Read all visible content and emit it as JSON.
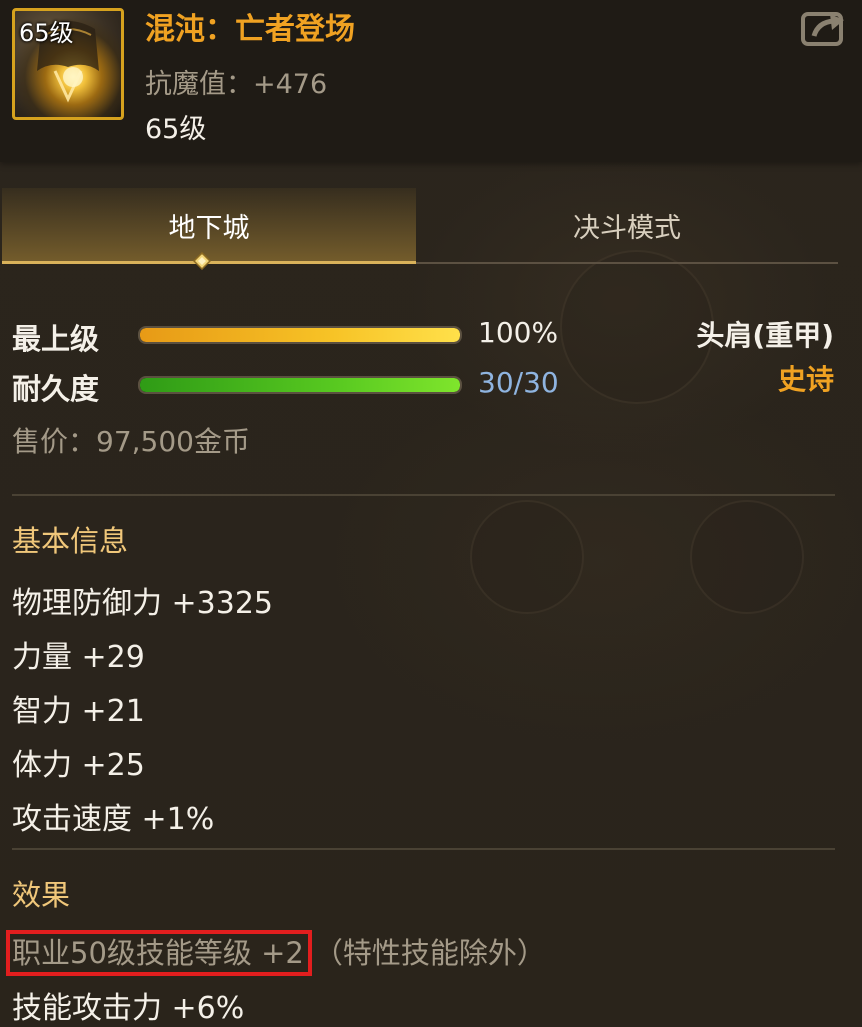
{
  "item": {
    "icon_level": "65级",
    "name": "混沌：亡者登场",
    "resist": "抗魔值：+476",
    "level": "65级",
    "share_icon": "share-icon"
  },
  "tabs": [
    {
      "label": "地下城",
      "active": true
    },
    {
      "label": "决斗模式",
      "active": false
    }
  ],
  "grade": {
    "label": "最上级",
    "value_text": "100%",
    "fill_fraction": 1.0,
    "color": "#f7c326"
  },
  "durability": {
    "label": "耐久度",
    "value_text": "30/30",
    "fill_fraction": 1.0,
    "color": "#57c820",
    "value_color": "#8fb4e0"
  },
  "slot": "头肩(重甲)",
  "rarity": "史诗",
  "price": "售价：97,500金币",
  "basic_info": {
    "title": "基本信息",
    "stats": [
      "物理防御力 +3325",
      "力量 +29",
      "智力 +21",
      "体力 +25",
      "攻击速度 +1%"
    ]
  },
  "effects": {
    "title": "效果",
    "highlighted": "职业50级技能等级 +2",
    "note": "（特性技能除外）",
    "second": "技能攻击力 +6%"
  },
  "colors": {
    "name": "#f0a222",
    "section_title": "#f0c77a",
    "highlight_box": "#e21e1e",
    "muted_text": "#a49a88"
  }
}
